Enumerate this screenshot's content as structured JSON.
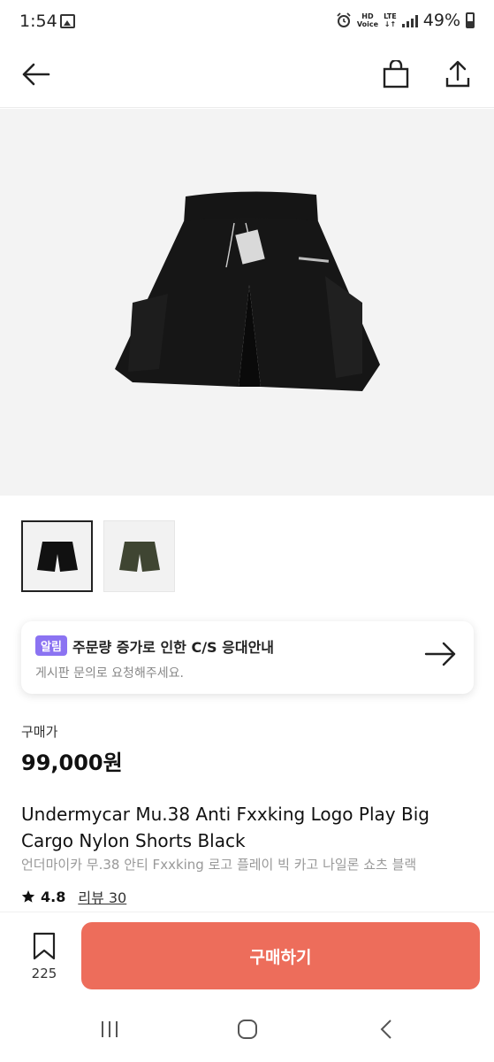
{
  "status_bar": {
    "time": "1:54",
    "hd_top": "HD",
    "hd_bottom": "Voice",
    "lte_top": "LTE",
    "lte_bottom": "↓↑",
    "battery": "49%"
  },
  "header": {
    "back_icon": "arrow-left-icon",
    "bag_icon": "shopping-bag-icon",
    "share_icon": "share-upload-icon"
  },
  "product": {
    "image_desc_icon": "black-cargo-shorts",
    "thumbnails": [
      {
        "color": "#111111",
        "active": true
      },
      {
        "color": "#3f4532",
        "active": false
      }
    ],
    "price_label": "구매가",
    "price": "99,000원",
    "title_en": "Undermycar Mu.38 Anti Fxxking Logo Play Big Cargo Nylon Shorts Black",
    "title_ko": "언더마이카 무.38 안티 Fxxking 로고 플레이 빅 카고 나일론 쇼츠 블랙",
    "rating": "4.8",
    "review_label": "리뷰 30"
  },
  "notice": {
    "badge": "알림",
    "title": "주문량 증가로 인한 C/S 응대안내",
    "subtitle": "게시판 문의로 요청해주세요.",
    "badge_color": "#8b73f2"
  },
  "action_bar": {
    "wish_count": "225",
    "buy_label": "구매하기",
    "buy_color": "#ed6d5b"
  }
}
